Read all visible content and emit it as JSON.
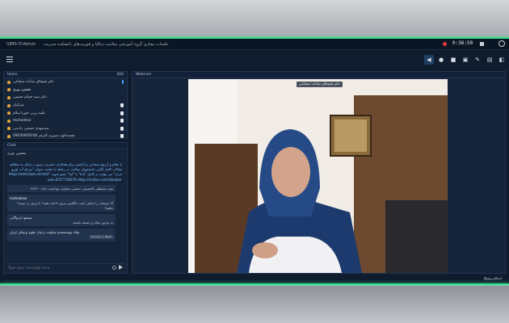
{
  "titlebar": {
    "app_name": "IUMS-IT-Admin",
    "separator": "-",
    "course": "جلسات مجازی گروه آموزشی سلامت دیتالیا و فوریت‌های دانشکده مدیریت",
    "timer": "0:36:50"
  },
  "toolbar": {
    "tools": [
      "volume-icon",
      "mic-icon",
      "camera-icon",
      "screen-share-icon",
      "pen-icon",
      "file-icon",
      "window-icon"
    ]
  },
  "users_panel": {
    "title": "Users",
    "count": "404",
    "users": [
      {
        "name": "دکتر قیشلاق سادات شجاعی",
        "icon": "mic"
      },
      {
        "name": "محسن نوری",
        "icon": "none"
      },
      {
        "name": "دکتر سید حسام حسینی",
        "icon": "none"
      },
      {
        "name": "شرکیان",
        "icon": "hand"
      },
      {
        "name": "طیبه زربی جوزیا سلام",
        "icon": "hand"
      },
      {
        "name": "mohadese",
        "icon": "hand"
      },
      {
        "name": "سیدمهدی حسینی زاده‌تی",
        "icon": "hand"
      },
      {
        "name": "09630909208 محمدجاوید نصیری کاترای",
        "icon": "hand"
      }
    ]
  },
  "chat_panel": {
    "title": "Chat",
    "pinned_user": "محسن نوری",
    "announcement": "با سلام و آرزوی سعادتی و آرامش برای همکاران محترم درصورت تمایل به مطالعه مقالات کامل آنلاین دانشجویان سلامت در رابطه با تمامت عنوان \"سرای آب اوریو ایران\" می توانید در کانال \"تاجا\" یا \"اینا\" عضو شوید. https://web.bale.ai/chat?uid=6257728076 https://rvillas.com/dlaspter",
    "messages": [
      {
        "author": "",
        "text": "سید مصطفی الحسینی حسینی معاونت بهداشت خانه‌۳۶۷۲۰۰"
      },
      {
        "author": "mohadese",
        "text": "آیا دوستان را ممکن است انگلیس بیرون ادامه دهید؟ یا بیرون را ببینید؟ ماهم؟"
      },
      {
        "author": "مسعود اردوگانی",
        "text": "به عرض سلام و خسته نباشید"
      },
      {
        "author": "میلاد توسنجمدی معاونت درمان علوم پزشکی ایران",
        "text": "09360219801"
      }
    ],
    "input_placeholder": "Type your message here"
  },
  "webcam_panel": {
    "title": "Webcam",
    "presenter": "دکتر قیشلاق سادات شجاعی"
  },
  "footer": {
    "label": "@اسکای‌روم"
  },
  "colors": {
    "accent_glow": "#35e08a",
    "app_bg": "#0f1c2e",
    "panel_bg": "#16243a",
    "link": "#7fc3ff",
    "record": "#e23b3b"
  }
}
